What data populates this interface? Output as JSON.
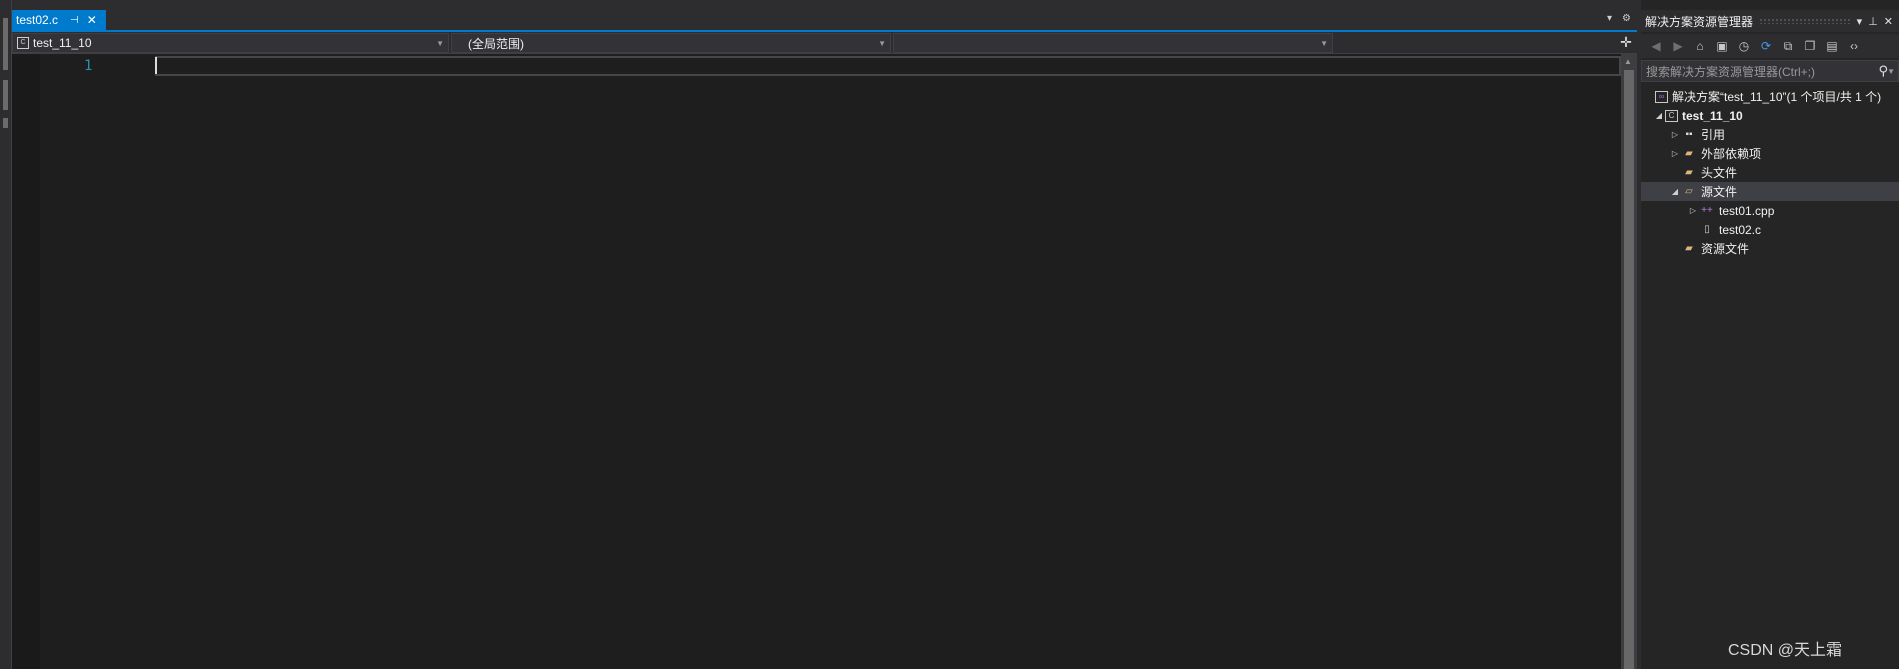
{
  "editor": {
    "tab": {
      "title": "test02.c",
      "pin_glyph": "⊣",
      "close_glyph": "✕"
    },
    "tab_controls": {
      "dropdown_glyph": "▾",
      "settings_glyph": "⚙"
    },
    "nav": {
      "project": "test_11_10",
      "scope": "(全局范围)",
      "member": "",
      "split_glyph": "✛"
    },
    "code": {
      "line_numbers": [
        "1"
      ]
    }
  },
  "solution_explorer": {
    "title": "解决方案资源管理器",
    "title_controls": {
      "dropdown": "▾",
      "pin": "⊥",
      "close": "✕"
    },
    "search_placeholder": "搜索解决方案资源管理器(Ctrl+;)",
    "search_glyph": "⚲",
    "toolbar_icons": [
      "back-icon",
      "forward-icon",
      "home-icon",
      "vs-solution-icon",
      "history-icon",
      "sync-icon",
      "collapse-icon",
      "copy-icon",
      "properties-icon",
      "code-view-icon"
    ],
    "tree": [
      {
        "label": "解决方案“test_11_10”(1 个项目/共 1 个)",
        "icon": "solution-icon",
        "level": 0
      },
      {
        "label": "test_11_10",
        "icon": "project-icon",
        "level": 0,
        "expanded": true,
        "bold": true
      },
      {
        "label": "引用",
        "icon": "references-icon",
        "level": 1,
        "expanded": false
      },
      {
        "label": "外部依赖项",
        "icon": "folder-icon",
        "level": 1,
        "expanded": false
      },
      {
        "label": "头文件",
        "icon": "folder-icon",
        "level": 1
      },
      {
        "label": "源文件",
        "icon": "folder-open-icon",
        "level": 1,
        "expanded": true,
        "selected": true
      },
      {
        "label": "test01.cpp",
        "icon": "cpp-file-icon",
        "level": 2,
        "expanded": false
      },
      {
        "label": "test02.c",
        "icon": "c-file-icon",
        "level": 2
      },
      {
        "label": "资源文件",
        "icon": "folder-icon",
        "level": 1
      }
    ]
  },
  "watermark": "CSDN @天上霜",
  "colors": {
    "accent": "#007acc",
    "editor_bg": "#1e1e1e",
    "chrome_bg": "#2d2d30",
    "line_number": "#2b91af",
    "selection": "#3f3f46"
  }
}
